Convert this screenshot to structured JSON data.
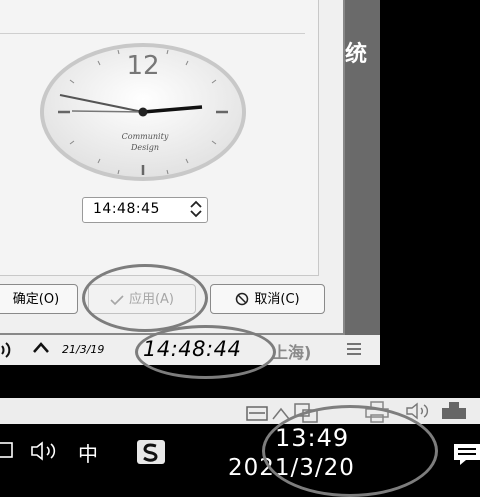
{
  "desktop": {
    "right_glyph": "统"
  },
  "clock": {
    "twelve": "12",
    "brand_line1": "Community",
    "brand_line2": "Design"
  },
  "time_spin": {
    "value": "14:48:45"
  },
  "buttons": {
    "ok_label": "确定(O)",
    "apply_label": "应用(A)",
    "cancel_label": "取消(C)"
  },
  "panel": {
    "date": "21/3/19",
    "time": "14:48:44",
    "zone": "上海)"
  },
  "taskbar": {
    "ime": "中",
    "time": "13:49",
    "date": "2021/3/20"
  },
  "icons": [
    "window-icon",
    "speaker-icon",
    "sogou-icon",
    "notification-icon",
    "arrow-up-icon",
    "menu-icon",
    "printer-icon",
    "usb-icon",
    "network-icon",
    "check-icon",
    "ban-icon",
    "spinner-arrows-icon"
  ]
}
